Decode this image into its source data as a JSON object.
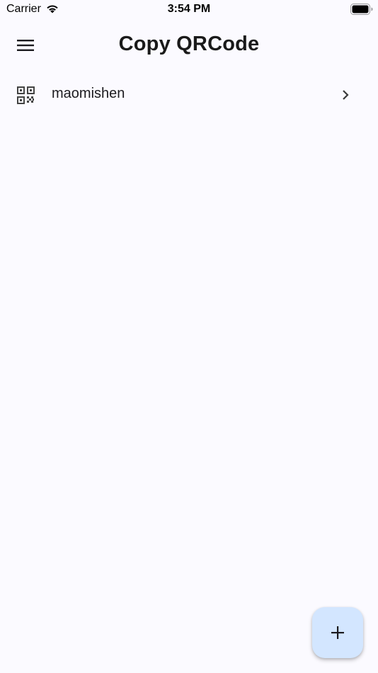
{
  "status_bar": {
    "carrier": "Carrier",
    "time": "3:54 PM",
    "wifi_icon": "wifi-icon",
    "battery_icon": "battery-full-icon"
  },
  "app_bar": {
    "title": "Copy QRCode",
    "menu_icon": "hamburger-menu-icon"
  },
  "list": {
    "items": [
      {
        "label": "maomishen",
        "leading_icon": "qr-code-icon",
        "trailing_icon": "chevron-right-icon"
      }
    ]
  },
  "fab": {
    "icon": "plus-icon",
    "color": "#d3e6ff"
  },
  "colors": {
    "background": "#fbfaff",
    "text": "#1c1b1f"
  }
}
